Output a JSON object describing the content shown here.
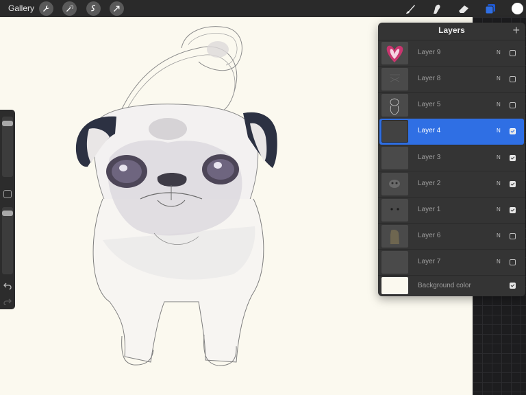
{
  "topbar": {
    "gallery_label": "Gallery",
    "left_tools": [
      "wrench-icon",
      "magic-wand-icon",
      "selection-icon",
      "transform-arrow-icon"
    ],
    "right_tools": [
      "brush-icon",
      "smudge-icon",
      "eraser-icon",
      "layers-icon"
    ],
    "active_color": "#ffffff",
    "layers_active_color": "#2f6fe4"
  },
  "sidebar": {
    "brush_size_level": 0.07,
    "opacity_level": 0.05,
    "icons": [
      "square-modify-icon",
      "undo-icon",
      "redo-icon"
    ]
  },
  "layers": {
    "title": "Layers",
    "add_icon": "+",
    "items": [
      {
        "name": "Layer 9",
        "blend": "N",
        "visible": false,
        "selected": false
      },
      {
        "name": "Layer 8",
        "blend": "N",
        "visible": false,
        "selected": false
      },
      {
        "name": "Layer 5",
        "blend": "N",
        "visible": false,
        "selected": false
      },
      {
        "name": "Layer 4",
        "blend": "N",
        "visible": true,
        "selected": true
      },
      {
        "name": "Layer 3",
        "blend": "N",
        "visible": true,
        "selected": false
      },
      {
        "name": "Layer 2",
        "blend": "N",
        "visible": true,
        "selected": false
      },
      {
        "name": "Layer 1",
        "blend": "N",
        "visible": true,
        "selected": false
      },
      {
        "name": "Layer 6",
        "blend": "N",
        "visible": false,
        "selected": false
      },
      {
        "name": "Layer 7",
        "blend": "N",
        "visible": false,
        "selected": false
      }
    ],
    "background": {
      "name": "Background color",
      "visible": true
    }
  },
  "colors": {
    "canvas": "#fbf9ef",
    "selection": "#2f6fe4",
    "panel": "#343434"
  }
}
